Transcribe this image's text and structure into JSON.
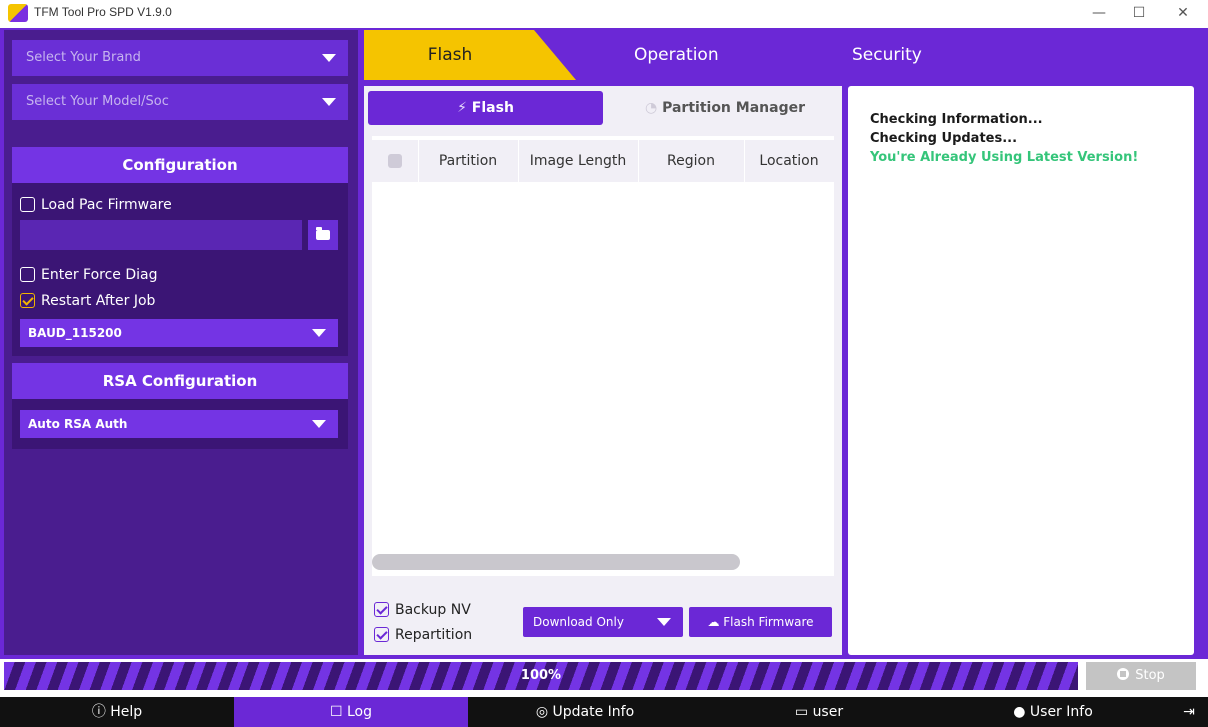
{
  "window": {
    "title": "TFM Tool Pro SPD V1.9.0",
    "minimize_glyph": "—",
    "maximize_glyph": "☐",
    "close_glyph": "✕"
  },
  "sidebar": {
    "brand_placeholder": "Select Your Brand",
    "model_placeholder": "Select Your Model/Soc",
    "configuration": {
      "title": "Configuration",
      "load_pac": {
        "label": "Load Pac Firmware",
        "checked": false
      },
      "firmware_path": "",
      "enter_force_diag": {
        "label": "Enter Force Diag",
        "checked": false
      },
      "restart_after_job": {
        "label": "Restart After Job",
        "checked": true
      },
      "baud_rate": "BAUD_115200"
    },
    "rsa": {
      "title": "RSA Configuration",
      "mode": "Auto RSA Auth"
    }
  },
  "top_tabs": [
    {
      "label": "Flash",
      "active": true
    },
    {
      "label": "Operation",
      "active": false
    },
    {
      "label": "Security",
      "active": false
    }
  ],
  "sub_tabs": {
    "flash": {
      "label": "Flash",
      "icon": "flash-icon",
      "active": true
    },
    "partition_manager": {
      "label": "Partition Manager",
      "icon": "pie-chart-icon",
      "active": false
    }
  },
  "partition_table": {
    "columns": [
      "Partition",
      "Image Length",
      "Region",
      "Location"
    ],
    "rows": []
  },
  "flash_options": {
    "backup_nv": {
      "label": "Backup NV",
      "checked": true
    },
    "repartition": {
      "label": "Repartition",
      "checked": true
    },
    "mode": "Download Only",
    "flash_button": "Flash Firmware"
  },
  "log": {
    "lines": [
      {
        "text": "Checking Information...",
        "status": "normal"
      },
      {
        "text": "Checking Updates...",
        "status": "normal"
      },
      {
        "text": "You're Already Using Latest Version!",
        "status": "success"
      }
    ]
  },
  "progress": {
    "label": "100%",
    "value": 1.0
  },
  "stop_button": "Stop",
  "status_bar": {
    "help": "Help",
    "log": "Log",
    "update_info": "Update Info",
    "user": "user",
    "user_info": "User Info"
  },
  "colors": {
    "primary": "#6b28d6",
    "sidebar": "#4a1d8f",
    "accent_tab": "#f5c400",
    "success_text": "#35c57a",
    "statusbar": "#111111"
  }
}
